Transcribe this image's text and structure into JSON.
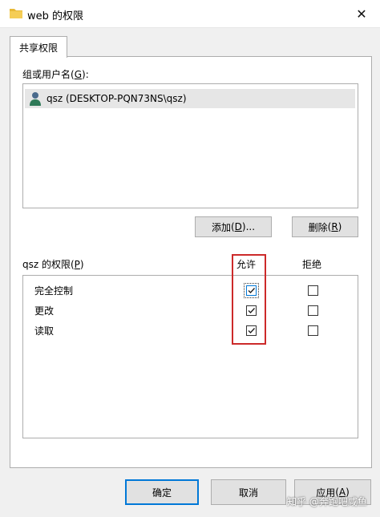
{
  "window": {
    "title": "web 的权限",
    "close_glyph": "✕"
  },
  "tabs": [
    {
      "label": "共享权限"
    }
  ],
  "groups": {
    "label": "组或用户名",
    "accel": "G",
    "items": [
      {
        "name": "qsz (DESKTOP-PQN73NS\\qsz)",
        "icon": "user-icon"
      }
    ]
  },
  "buttons": {
    "add": {
      "label": "添加",
      "accel": "D",
      "suffix": "..."
    },
    "remove": {
      "label": "删除",
      "accel": "R"
    },
    "ok": {
      "label": "确定"
    },
    "cancel": {
      "label": "取消"
    },
    "apply": {
      "label": "应用",
      "accel": "A"
    }
  },
  "permissions": {
    "title_prefix": "qsz 的权限",
    "accel": "P",
    "allow_header": "允许",
    "deny_header": "拒绝",
    "rows": [
      {
        "name": "完全控制",
        "allow": true,
        "deny": false
      },
      {
        "name": "更改",
        "allow": true,
        "deny": false
      },
      {
        "name": "读取",
        "allow": true,
        "deny": false
      }
    ]
  },
  "watermark": "知乎 @奔跑吧咸鱼",
  "colors": {
    "highlight": "#cc2a2a",
    "focus": "#0078d7"
  }
}
